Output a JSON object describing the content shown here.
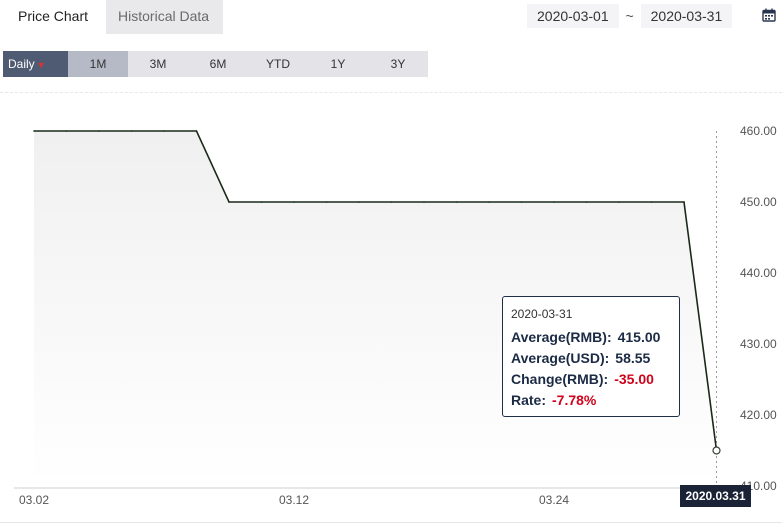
{
  "tabs": {
    "price_chart": "Price Chart",
    "historical_data": "Historical Data"
  },
  "date_range": {
    "start": "2020-03-01",
    "separator": "~",
    "end": "2020-03-31"
  },
  "icons": {
    "calendar": "calendar-icon",
    "dropdown": "caret-down-icon"
  },
  "periods": {
    "daily": "Daily",
    "caret": "▼",
    "m1": "1M",
    "m3": "3M",
    "m6": "6M",
    "ytd": "YTD",
    "y1": "1Y",
    "y3": "3Y"
  },
  "tooltip": {
    "date": "2020-03-31",
    "avg_rmb_label": "Average(RMB):",
    "avg_rmb_value": "415.00",
    "avg_usd_label": "Average(USD):",
    "avg_usd_value": "58.55",
    "change_label": "Change(RMB):",
    "change_value": "-35.00",
    "rate_label": "Rate:",
    "rate_value": "-7.78%"
  },
  "cursor_label": "2020.03.31",
  "colors": {
    "line": "#1a2a1a",
    "selected_tab": "#4f5a73",
    "negative": "#d0021b",
    "badge": "#1b2436"
  },
  "chart_data": {
    "type": "area",
    "x": [
      "2020-03-02",
      "2020-03-03",
      "2020-03-04",
      "2020-03-05",
      "2020-03-06",
      "2020-03-09",
      "2020-03-10",
      "2020-03-11",
      "2020-03-12",
      "2020-03-13",
      "2020-03-16",
      "2020-03-17",
      "2020-03-18",
      "2020-03-19",
      "2020-03-20",
      "2020-03-23",
      "2020-03-24",
      "2020-03-25",
      "2020-03-26",
      "2020-03-27",
      "2020-03-30",
      "2020-03-31"
    ],
    "values": [
      460,
      460,
      460,
      460,
      460,
      460,
      450,
      450,
      450,
      450,
      450,
      450,
      450,
      450,
      450,
      450,
      450,
      450,
      450,
      450,
      450,
      415
    ],
    "xticks": [
      {
        "index": 0,
        "label": "03.02"
      },
      {
        "index": 8,
        "label": "03.12"
      },
      {
        "index": 16,
        "label": "03.24"
      }
    ],
    "yticks": [
      "410.00",
      "420.00",
      "430.00",
      "440.00",
      "450.00",
      "460.00"
    ],
    "ylim": [
      410,
      460
    ],
    "highlight_index": 21,
    "grid": false
  }
}
